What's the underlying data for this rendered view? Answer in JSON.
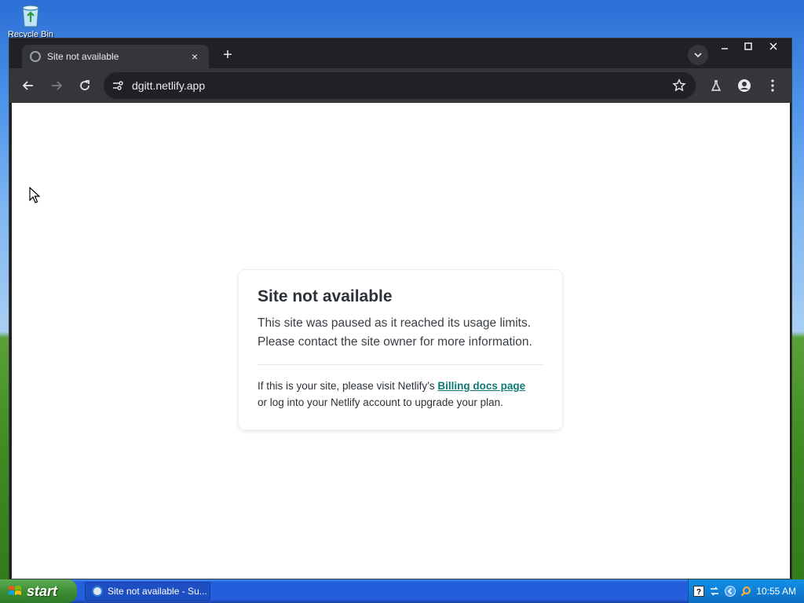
{
  "desktop": {
    "icons": [
      {
        "label": "Recycle Bin",
        "icon": "recycle-bin-icon"
      }
    ]
  },
  "browser": {
    "tab": {
      "title": "Site not available",
      "close": "×"
    },
    "new_tab": "+",
    "toolbar": {
      "url": "dgitt.netlify.app"
    }
  },
  "page": {
    "title": "Site not available",
    "message_line1": "This site was paused as it reached its usage limits.",
    "message_line2": "Please contact the site owner for more information.",
    "owner_prefix": "If this is your site, please visit Netlify’s ",
    "link_text": "Billing docs page",
    "owner_suffix": "or log into your Netlify account to upgrade your plan.",
    "link_color": "#0e7a73"
  },
  "taskbar": {
    "start_label": "start",
    "task_button_label": "Site not available - Su...",
    "clock": "10:55 AM"
  }
}
